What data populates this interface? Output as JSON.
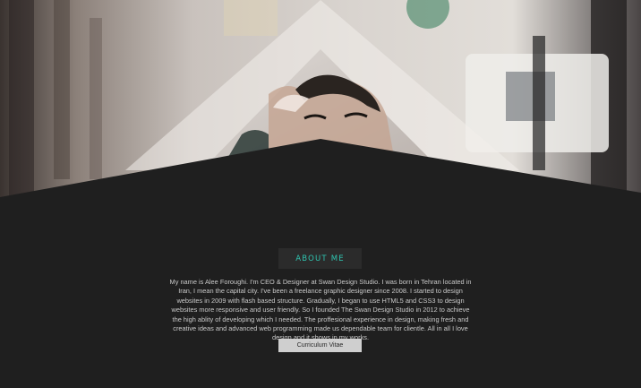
{
  "about": {
    "heading": "ABOUT ME",
    "bio": "My name is Alee Foroughi. I'm CEO & Designer at Swan Design Studio. I was born in Tehran located in Iran, I mean the capital city. I've been a freelance graphic designer since 2008. I started to design websites in 2009 with flash based structure. Gradually, I began to use HTML5 and CSS3 to design websites more responsive and user friendly. So I founded The Swan Design Studio in 2012 to achieve the high ablity of developing which I needed. The proffesional experience in design, making fresh and creative ideas and advanced web programming made us dependable team for clientle. All in all I love design and it shows in my works.",
    "cv_button_label": "Curriculum Vitae"
  },
  "colors": {
    "background": "#1f1f1f",
    "accent": "#2fc4b0",
    "heading_box": "#2b2b2b",
    "button": "#cfcfcf"
  }
}
